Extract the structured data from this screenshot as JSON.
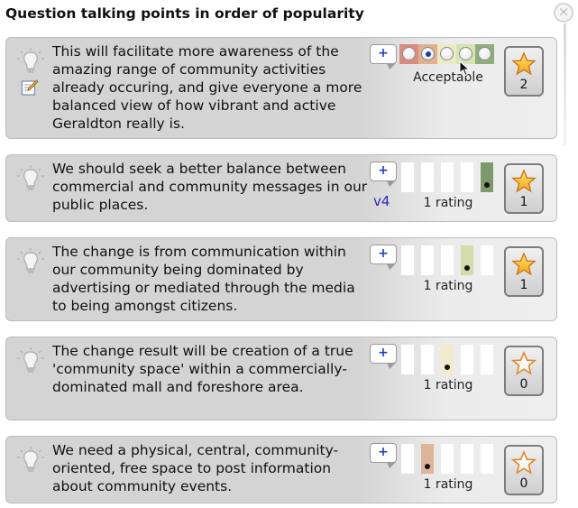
{
  "panel": {
    "title": "Question talking points in order of popularity",
    "close_symbol": "×"
  },
  "points": [
    {
      "text": "This will facilitate more awareness of the amazing range of community activities already occuring, and give everyone a more balanced view of how vibrant and active Geraldton really is.",
      "add_label": "+",
      "rating_label": "Acceptable",
      "rating_scale": {
        "segment_colors": [
          "#d98b80",
          "#e0b08f",
          "#ecebc6",
          "#d6e3b5",
          "#8fae7e"
        ],
        "checked_index": 1
      },
      "has_edit_icon": true,
      "star_count": "2",
      "star_filled": true
    },
    {
      "text": "We should seek a better balance between commercial and community messages in our public places.",
      "add_label": "+",
      "version": "v4",
      "rating_label": "1 rating",
      "marked_slot": 4,
      "marked_color": "#7d9a6d",
      "star_count": "1",
      "star_filled": true
    },
    {
      "text": "The change is from communication within our community being dominated by advertising or mediated through the media to being amongst citizens.",
      "add_label": "+",
      "rating_label": "1 rating",
      "marked_slot": 3,
      "marked_color": "#d3dcaa",
      "star_count": "1",
      "star_filled": true
    },
    {
      "text": "The change result will be creation of a true 'community space' within a commercially-dominated mall and foreshore area.",
      "add_label": "+",
      "rating_label": "1 rating",
      "marked_slot": 2,
      "marked_color": "#f0eccb",
      "star_count": "0",
      "star_filled": false
    },
    {
      "text": "We need a physical, central, community-oriented, free space to post information about community events.",
      "add_label": "+",
      "rating_label": "1 rating",
      "marked_slot": 1,
      "marked_color": "#deb59a",
      "star_count": "0",
      "star_filled": false
    }
  ],
  "icons": {
    "bulb": "lightbulb-icon",
    "edit": "edit-pencil-icon",
    "star": "star-icon",
    "close": "close-icon"
  }
}
